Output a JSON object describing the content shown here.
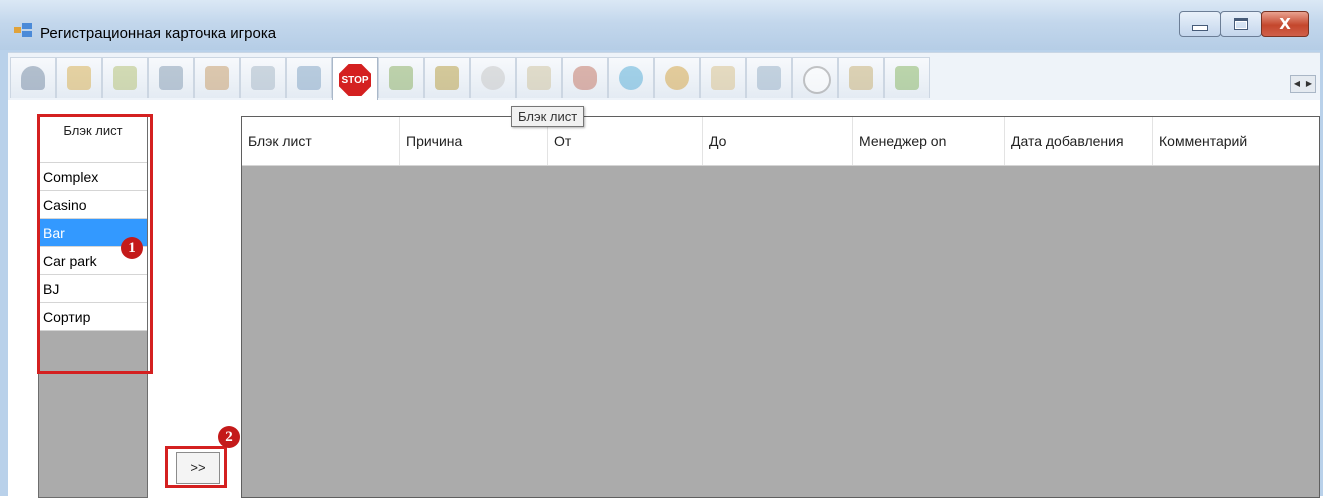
{
  "window": {
    "title": "Регистрационная карточка игрока",
    "close_glyph": "X"
  },
  "toolbar": {
    "icons": [
      "user-icon",
      "lock-icon",
      "map-icon",
      "card-icon",
      "document-icon",
      "folder-icon",
      "chip-icon",
      "stop-icon",
      "people-icon",
      "chart-icon",
      "coin-icon",
      "pen-icon",
      "cigar-icon",
      "calculator-icon",
      "burger-icon",
      "bag-icon",
      "files-icon",
      "clock-icon",
      "trophy-icon",
      "more-icon"
    ],
    "stop_label": "STOP",
    "tooltip": "Блэк лист"
  },
  "list": {
    "header": "Блэк лист",
    "items": [
      "Complex",
      "Casino",
      "Bar",
      "Car park",
      "BJ",
      "Сортир"
    ],
    "selected": "Bar"
  },
  "move_button": ">>",
  "badges": [
    "1",
    "2"
  ],
  "grid": {
    "columns": [
      "Блэк лист",
      "Причина",
      "От",
      "До",
      "Менеджер on",
      "Дата добавления",
      "Комментарий"
    ]
  }
}
